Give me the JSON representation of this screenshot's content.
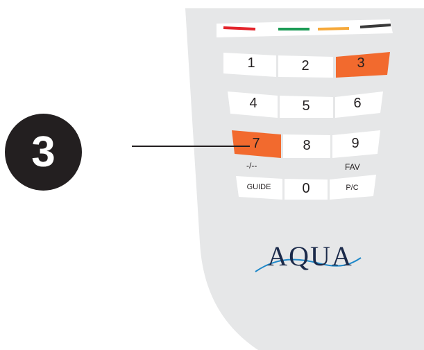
{
  "callout": {
    "number": "3"
  },
  "color_keys": [
    {
      "name": "red",
      "color": "#e3242b"
    },
    {
      "name": "green",
      "color": "#1b9a55"
    },
    {
      "name": "yellow",
      "color": "#f6a93b"
    },
    {
      "name": "blue",
      "color": "#3a3a3a"
    }
  ],
  "keys": {
    "k1": "1",
    "k2": "2",
    "k3": "3",
    "k4": "4",
    "k5": "5",
    "k6": "6",
    "k7": "7",
    "k8": "8",
    "k9": "9",
    "guide": "GUIDE",
    "k0": "0",
    "pc": "P/C"
  },
  "sub_labels": {
    "dash": "-/--",
    "fav": "FAV"
  },
  "highlight_color": "#f26a2e",
  "brand": {
    "name": "AQUA"
  }
}
